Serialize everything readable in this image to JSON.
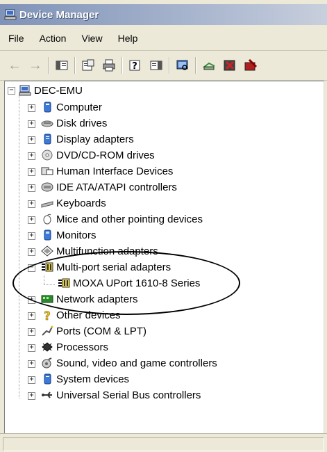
{
  "window": {
    "title": "Device Manager"
  },
  "menu": [
    "File",
    "Action",
    "View",
    "Help"
  ],
  "toolbar": {
    "buttons": [
      "back-icon",
      "forward-icon",
      "show-hide-console-tree-icon",
      "properties-icon",
      "print-icon",
      "help-icon",
      "show-hide-action-pane-icon",
      "scan-hardware-icon",
      "update-driver-icon",
      "disable-device-icon",
      "uninstall-device-icon"
    ]
  },
  "tree": {
    "root": "DEC-EMU",
    "categories": [
      {
        "label": "Computer",
        "icon": "computer-icon",
        "expanded": false
      },
      {
        "label": "Disk drives",
        "icon": "disk-drive-icon",
        "expanded": false
      },
      {
        "label": "Display adapters",
        "icon": "display-adapter-icon",
        "expanded": false
      },
      {
        "label": "DVD/CD-ROM drives",
        "icon": "cd-rom-icon",
        "expanded": false
      },
      {
        "label": "Human Interface Devices",
        "icon": "hid-icon",
        "expanded": false
      },
      {
        "label": "IDE ATA/ATAPI controllers",
        "icon": "ide-controller-icon",
        "expanded": false
      },
      {
        "label": "Keyboards",
        "icon": "keyboard-icon",
        "expanded": false
      },
      {
        "label": "Mice and other pointing devices",
        "icon": "mouse-icon",
        "expanded": false
      },
      {
        "label": "Monitors",
        "icon": "monitor-icon",
        "expanded": false
      },
      {
        "label": "Multifunction adapters",
        "icon": "multifunction-icon",
        "expanded": false
      },
      {
        "label": "Multi-port serial adapters",
        "icon": "serial-adapter-icon",
        "expanded": true,
        "children": [
          {
            "label": "MOXA UPort 1610-8 Series",
            "icon": "serial-adapter-icon"
          }
        ]
      },
      {
        "label": "Network adapters",
        "icon": "network-adapter-icon",
        "expanded": false
      },
      {
        "label": "Other devices",
        "icon": "unknown-device-icon",
        "expanded": false
      },
      {
        "label": "Ports (COM & LPT)",
        "icon": "port-icon",
        "expanded": false
      },
      {
        "label": "Processors",
        "icon": "processor-icon",
        "expanded": false
      },
      {
        "label": "Sound, video and game controllers",
        "icon": "sound-icon",
        "expanded": false
      },
      {
        "label": "System devices",
        "icon": "system-device-icon",
        "expanded": false
      },
      {
        "label": "Universal Serial Bus controllers",
        "icon": "usb-icon",
        "expanded": false
      }
    ]
  }
}
